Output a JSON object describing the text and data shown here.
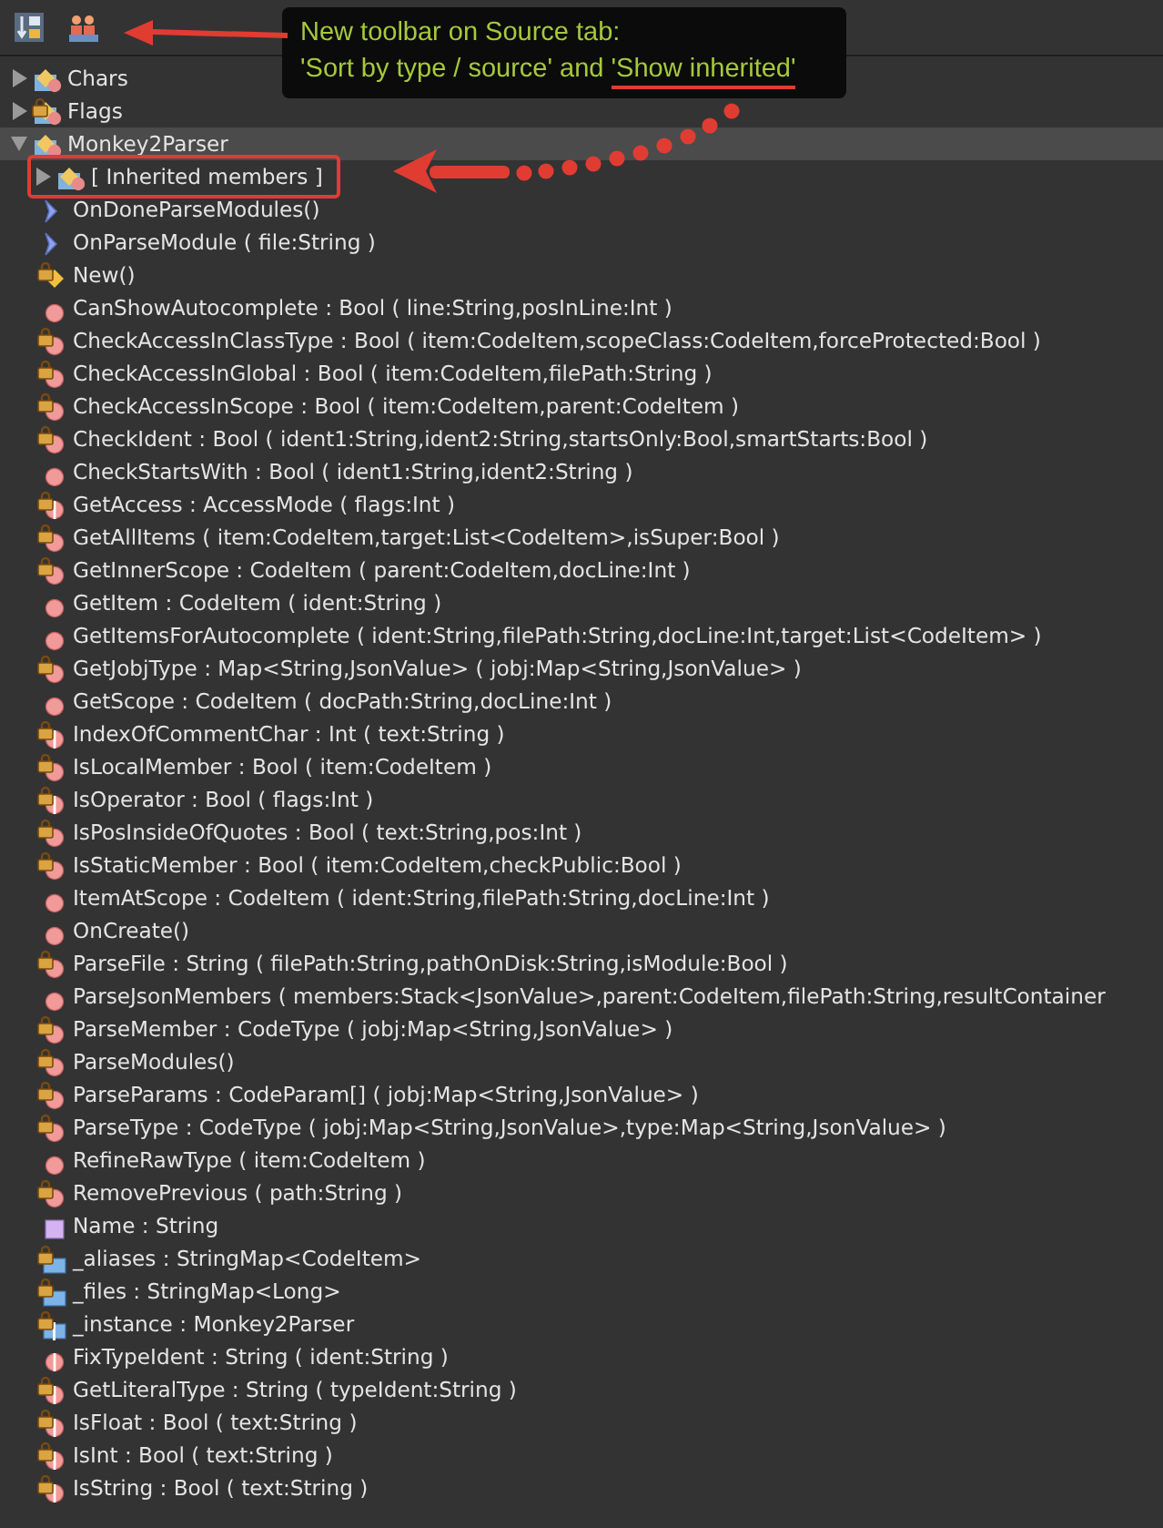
{
  "toolbar": {
    "buttons": [
      {
        "kind": "sort"
      },
      {
        "kind": "inherited"
      }
    ]
  },
  "callout": {
    "line_1": "New toolbar on Source tab:",
    "line_2": "'Sort by type / source' and",
    "line_2_highlight": "'Show inherited'"
  },
  "tree": [
    {
      "label": "Chars",
      "kind": "class",
      "locked": false,
      "expanded": false,
      "selected": false
    },
    {
      "label": "Flags",
      "kind": "class",
      "locked": true,
      "expanded": false,
      "selected": false
    },
    {
      "label": "Monkey2Parser",
      "kind": "class",
      "locked": false,
      "expanded": true,
      "selected": true,
      "children": [
        {
          "label": "[ Inherited members ]",
          "kind": "class",
          "locked": false,
          "expanded": false,
          "selected": false,
          "boxed": true
        },
        {
          "label": "OnDoneParseModules()",
          "kind": "event",
          "locked": false
        },
        {
          "label": "OnParseModule ( file:String )",
          "kind": "event",
          "locked": false
        },
        {
          "label": "New()",
          "kind": "ctor",
          "locked": true
        },
        {
          "label": "CanShowAutocomplete : Bool ( line:String,posInLine:Int )",
          "kind": "method",
          "locked": false
        },
        {
          "label": "CheckAccessInClassType : Bool ( item:CodeItem,scopeClass:CodeItem,forceProtected:Bool )",
          "kind": "method",
          "locked": true
        },
        {
          "label": "CheckAccessInGlobal : Bool ( item:CodeItem,filePath:String )",
          "kind": "method",
          "locked": true
        },
        {
          "label": "CheckAccessInScope : Bool ( item:CodeItem,parent:CodeItem )",
          "kind": "method",
          "locked": true
        },
        {
          "label": "CheckIdent : Bool ( ident1:String,ident2:String,startsOnly:Bool,smartStarts:Bool )",
          "kind": "method",
          "locked": true
        },
        {
          "label": "CheckStartsWith : Bool ( ident1:String,ident2:String )",
          "kind": "method",
          "locked": false
        },
        {
          "label": "GetAccess : AccessMode ( flags:Int )",
          "kind": "function",
          "locked": true
        },
        {
          "label": "GetAllItems ( item:CodeItem,target:List<CodeItem>,isSuper:Bool )",
          "kind": "method",
          "locked": true
        },
        {
          "label": "GetInnerScope : CodeItem ( parent:CodeItem,docLine:Int )",
          "kind": "method",
          "locked": true
        },
        {
          "label": "GetItem : CodeItem ( ident:String )",
          "kind": "method",
          "locked": false
        },
        {
          "label": "GetItemsForAutocomplete ( ident:String,filePath:String,docLine:Int,target:List<CodeItem> )",
          "kind": "method",
          "locked": false
        },
        {
          "label": "GetJobjType : Map<String,JsonValue> ( jobj:Map<String,JsonValue> )",
          "kind": "method",
          "locked": true
        },
        {
          "label": "GetScope : CodeItem ( docPath:String,docLine:Int )",
          "kind": "method",
          "locked": false
        },
        {
          "label": "IndexOfCommentChar : Int ( text:String )",
          "kind": "function",
          "locked": true
        },
        {
          "label": "IsLocalMember : Bool ( item:CodeItem )",
          "kind": "method",
          "locked": true
        },
        {
          "label": "IsOperator : Bool ( flags:Int )",
          "kind": "function",
          "locked": true
        },
        {
          "label": "IsPosInsideOfQuotes : Bool ( text:String,pos:Int )",
          "kind": "method",
          "locked": true
        },
        {
          "label": "IsStaticMember : Bool ( item:CodeItem,checkPublic:Bool )",
          "kind": "method",
          "locked": true
        },
        {
          "label": "ItemAtScope : CodeItem ( ident:String,filePath:String,docLine:Int )",
          "kind": "method",
          "locked": false
        },
        {
          "label": "OnCreate()",
          "kind": "method",
          "locked": false
        },
        {
          "label": "ParseFile : String ( filePath:String,pathOnDisk:String,isModule:Bool )",
          "kind": "method",
          "locked": true
        },
        {
          "label": "ParseJsonMembers ( members:Stack<JsonValue>,parent:CodeItem,filePath:String,resultContainer",
          "kind": "method",
          "locked": false
        },
        {
          "label": "ParseMember : CodeType ( jobj:Map<String,JsonValue> )",
          "kind": "method",
          "locked": true
        },
        {
          "label": "ParseModules()",
          "kind": "method",
          "locked": true
        },
        {
          "label": "ParseParams : CodeParam[] ( jobj:Map<String,JsonValue> )",
          "kind": "method",
          "locked": true
        },
        {
          "label": "ParseType : CodeType ( jobj:Map<String,JsonValue>,type:Map<String,JsonValue> )",
          "kind": "method",
          "locked": true
        },
        {
          "label": "RefineRawType ( item:CodeItem )",
          "kind": "method",
          "locked": false
        },
        {
          "label": "RemovePrevious ( path:String )",
          "kind": "method",
          "locked": true
        },
        {
          "label": "Name : String",
          "kind": "property",
          "locked": false
        },
        {
          "label": "_aliases : StringMap<CodeItem>",
          "kind": "field",
          "locked": true
        },
        {
          "label": "_files : StringMap<Long>",
          "kind": "field",
          "locked": true
        },
        {
          "label": "_instance : Monkey2Parser",
          "kind": "global",
          "locked": true
        }
      ]
    },
    {
      "label": "FixTypeIdent : String ( ident:String )",
      "kind": "function",
      "locked": false
    },
    {
      "label": "GetLiteralType : String ( typeIdent:String )",
      "kind": "function",
      "locked": true
    },
    {
      "label": "IsFloat : Bool ( text:String )",
      "kind": "function",
      "locked": true
    },
    {
      "label": "IsInt : Bool ( text:String )",
      "kind": "function",
      "locked": true
    },
    {
      "label": "IsString : Bool ( text:String )",
      "kind": "function",
      "locked": true
    }
  ]
}
